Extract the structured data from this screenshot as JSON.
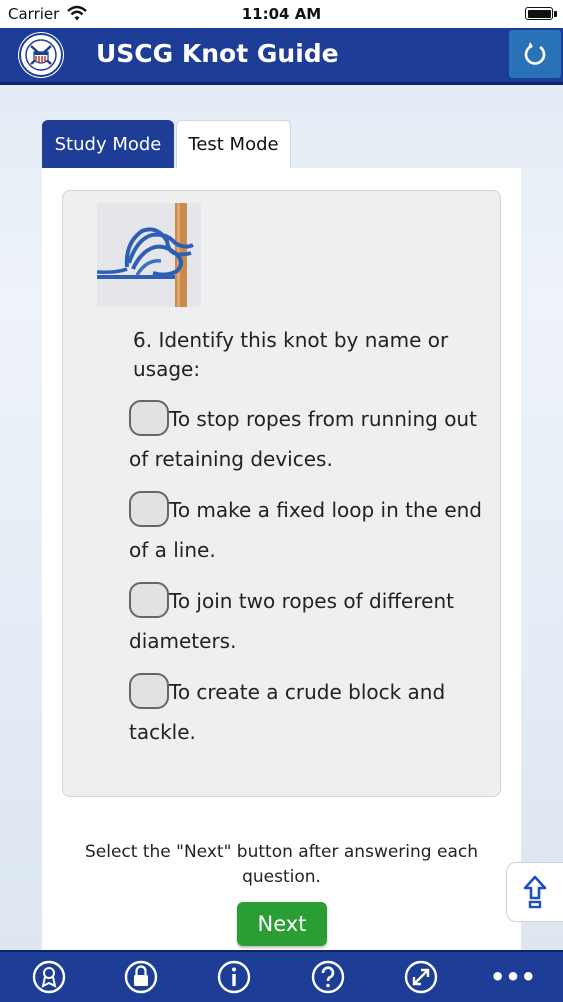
{
  "status_bar": {
    "carrier": "Carrier",
    "time": "11:04 AM"
  },
  "nav": {
    "title": "USCG Knot Guide",
    "refresh_icon": "refresh-icon",
    "logo_icon": "uscg-seal-icon"
  },
  "tabs": [
    {
      "label": "Study Mode",
      "active": true
    },
    {
      "label": "Test Mode",
      "active": false
    }
  ],
  "question": {
    "text": "6. Identify this knot by name or usage:",
    "image_icon": "knot-image",
    "options": [
      "To stop ropes from running out of retaining devices.",
      "To make a fixed loop in the end of a line.",
      "To join two ropes of different diameters.",
      "To create a crude block and tackle."
    ]
  },
  "instructions": "Select the \"Next\" button after answering each question.",
  "next_label": "Next",
  "bottom_nav": {
    "icons": [
      "award-icon",
      "lock-icon",
      "info-icon",
      "help-icon",
      "expand-icon",
      "more-icon"
    ],
    "more_label": "•••"
  },
  "colors": {
    "primary": "#1d3d96",
    "accent": "#2a72b8",
    "next": "#2a9d34"
  }
}
